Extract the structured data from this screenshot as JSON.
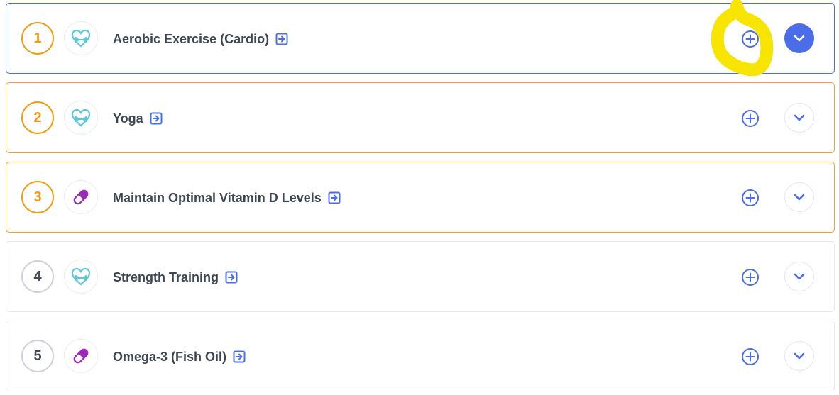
{
  "colors": {
    "accent_blue": "#4b6ee8",
    "rank_orange": "#f39c12",
    "rank_grey": "#cfd0da",
    "exercise_icon": "#5ec8d6",
    "supplement_icon": "#9b2bb5",
    "highlight_yellow": "#f7e400"
  },
  "items": [
    {
      "rank": "1",
      "title": "Aerobic Exercise (Cardio)",
      "category_icon": "heart-dumbbell-icon",
      "expanded": true
    },
    {
      "rank": "2",
      "title": "Yoga",
      "category_icon": "heart-dumbbell-icon",
      "expanded": false
    },
    {
      "rank": "3",
      "title": "Maintain Optimal Vitamin D Levels",
      "category_icon": "pill-icon",
      "expanded": false
    },
    {
      "rank": "4",
      "title": "Strength Training",
      "category_icon": "heart-dumbbell-icon",
      "expanded": false
    },
    {
      "rank": "5",
      "title": "Omega-3 (Fish Oil)",
      "category_icon": "pill-icon",
      "expanded": false
    }
  ]
}
